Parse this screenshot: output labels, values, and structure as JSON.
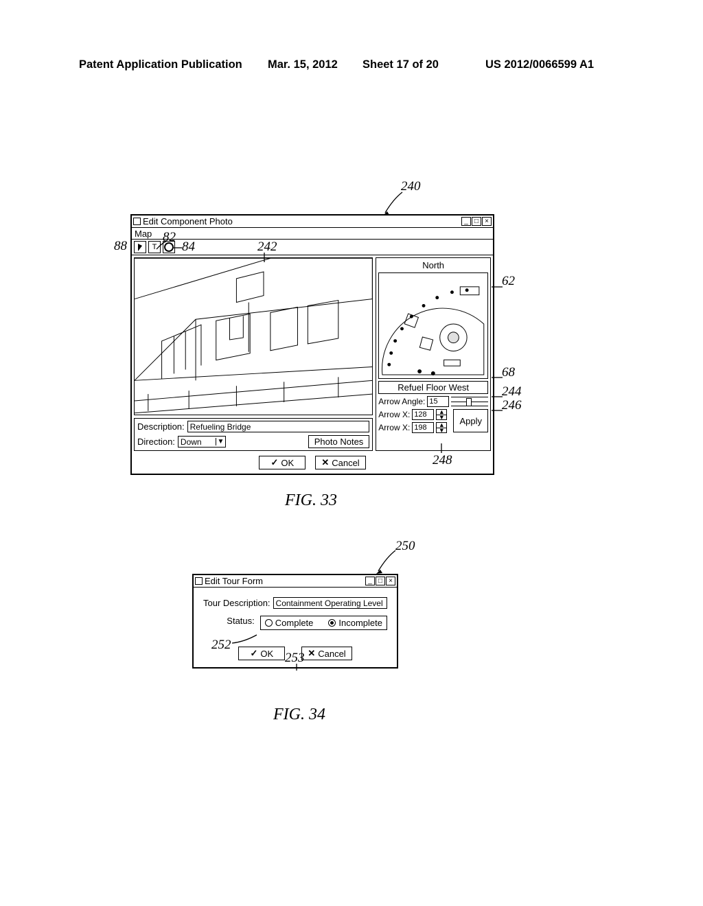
{
  "header": {
    "publication": "Patent Application Publication",
    "date": "Mar. 15, 2012",
    "sheet": "Sheet 17 of 20",
    "number": "US 2012/0066599 A1"
  },
  "callouts": {
    "c240": "240",
    "c88": "88",
    "c82": "82",
    "c84": "84",
    "c242": "242",
    "c62": "62",
    "c68": "68",
    "c244": "244",
    "c246": "246",
    "c248": "248",
    "c250": "250",
    "c252": "252",
    "c253": "253"
  },
  "fig33": {
    "caption": "FIG. 33",
    "title": "Edit Component Photo",
    "menubar": {
      "map": "Map"
    },
    "tools": {
      "cursor_name": "cursor-tool",
      "text_name": "text-tool",
      "text_label": "T",
      "circle_name": "circle-tool"
    },
    "north_label": "North",
    "map_name": "Refuel Floor West",
    "arrow_angle_label": "Arrow Angle:",
    "arrow_angle_value": "15",
    "arrow_x_label": "Arrow X:",
    "arrow_x_value": "128",
    "arrow_y_label": "Arrow X:",
    "arrow_y_value": "198",
    "apply_label": "Apply",
    "description_label": "Description:",
    "description_value": "Refueling Bridge",
    "direction_label": "Direction:",
    "direction_value": "Down",
    "photo_notes_label": "Photo Notes",
    "ok_label": "OK",
    "cancel_label": "Cancel"
  },
  "fig34": {
    "caption": "FIG. 34",
    "title": "Edit Tour Form",
    "tour_desc_label": "Tour Description:",
    "tour_desc_value": "Containment Operating Level",
    "status_label": "Status:",
    "radio_complete": "Complete",
    "radio_incomplete": "Incomplete",
    "ok_label": "OK",
    "cancel_label": "Cancel"
  }
}
